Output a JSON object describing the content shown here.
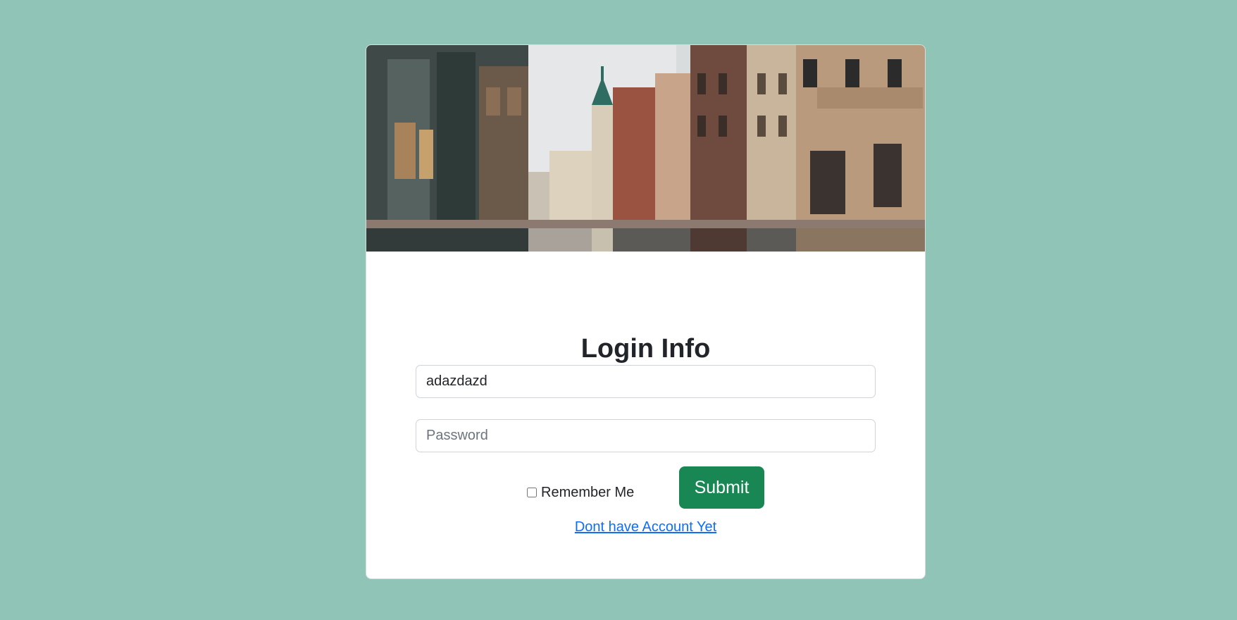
{
  "page": {
    "background_color": "#8fc4b6"
  },
  "card": {
    "hero_image": "street-photo",
    "title": "Login Info"
  },
  "form": {
    "username": {
      "value": "adazdazd",
      "placeholder": ""
    },
    "password": {
      "value": "",
      "placeholder": "Password"
    },
    "remember_label": "Remember Me",
    "remember_checked": false,
    "submit_label": "Submit",
    "submit_color": "#198754",
    "signup_link": "Dont have Account Yet",
    "link_color": "#0d6efd"
  }
}
